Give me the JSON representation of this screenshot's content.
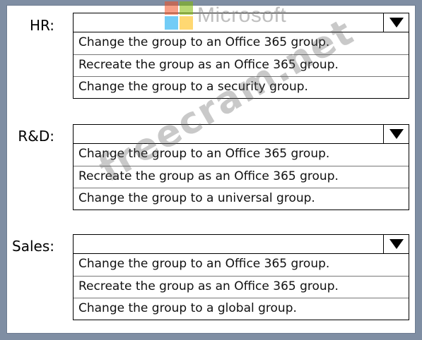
{
  "watermark_logo": {
    "text": "Microsoft",
    "colors": [
      "#f25022",
      "#7fba00",
      "#00a4ef",
      "#ffb900"
    ],
    "icon": "microsoft-logo-icon"
  },
  "watermark_site": "freecram.net",
  "rows": [
    {
      "label": "HR:",
      "dropdown_value": "",
      "options": [
        "Change the group to an Office 365 group.",
        "Recreate the group as an Office 365 group.",
        "Change the group to a security group."
      ]
    },
    {
      "label": "R&D:",
      "dropdown_value": "",
      "options": [
        "Change the group to an Office 365 group.",
        "Recreate the group as an Office 365 group.",
        "Change the group to a universal group."
      ]
    },
    {
      "label": "Sales:",
      "dropdown_value": "",
      "options": [
        "Change the group to an Office 365 group.",
        "Recreate the group as an Office 365 group.",
        "Change the group to a global group."
      ]
    }
  ],
  "arrow_icon": "triangle-down-icon"
}
